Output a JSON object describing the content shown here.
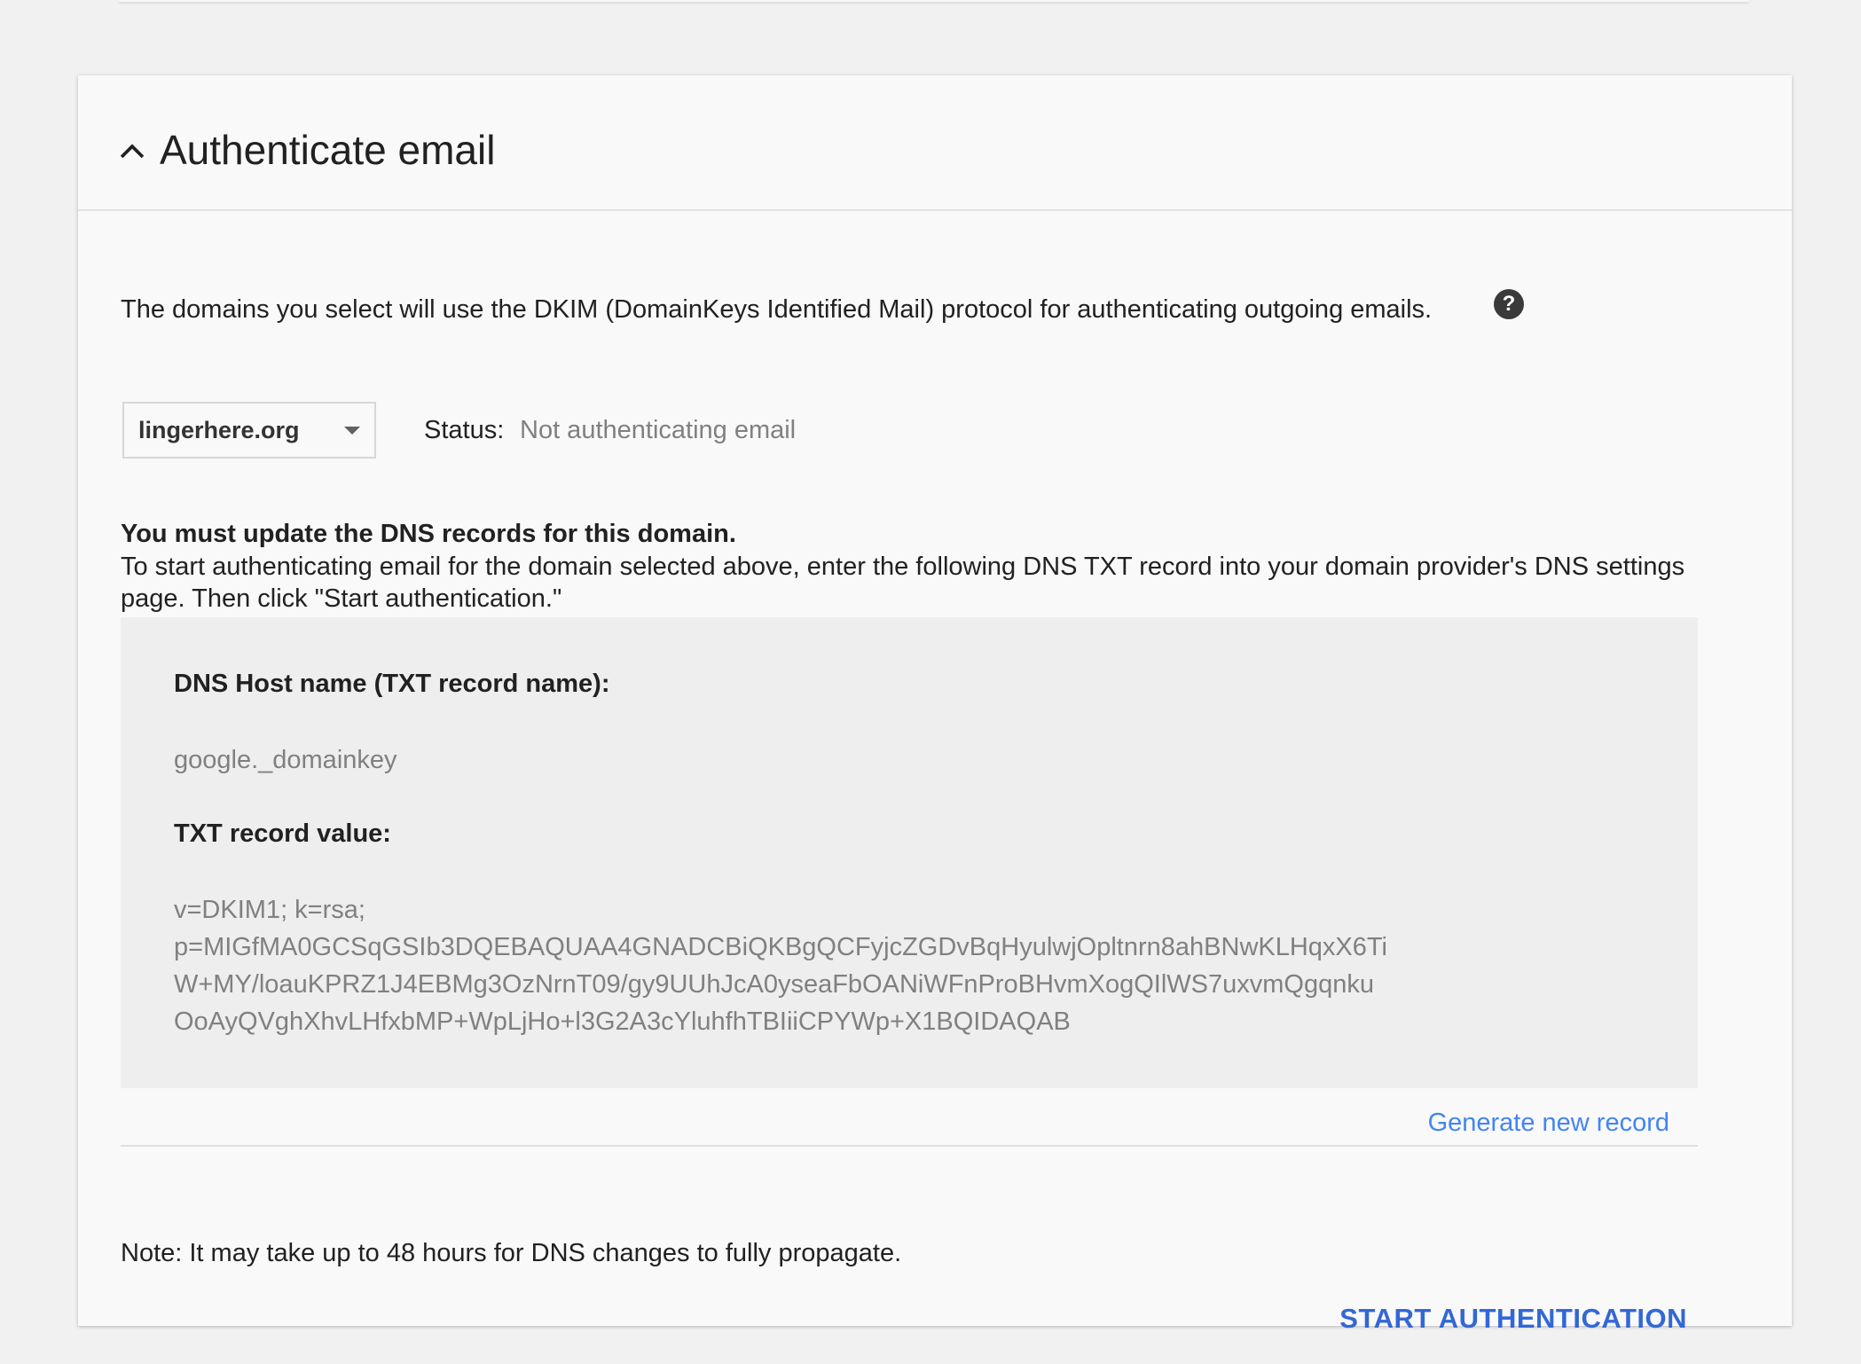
{
  "card": {
    "title": "Authenticate email"
  },
  "description": "The domains you select will use the DKIM (DomainKeys Identified Mail) protocol for authenticating outgoing emails.",
  "help_icon": "?",
  "domain_select": {
    "value": "lingerhere.org"
  },
  "status": {
    "label": "Status:",
    "value": "Not authenticating email"
  },
  "dns": {
    "warning_title": "You must update the DNS records for this domain.",
    "instructions": "To start authenticating email for the domain selected above, enter the following DNS TXT record into your domain provider's DNS settings page. Then click \"Start authentication.\"",
    "host_label": "DNS Host name (TXT record name):",
    "host_value": "google._domainkey",
    "txt_label": "TXT record value:",
    "txt_value": "v=DKIM1; k=rsa;\np=MIGfMA0GCSqGSIb3DQEBAQUAA4GNADCBiQKBgQCFyjcZGDvBqHyulwjOpltnrn8ahBNwKLHqxX6Ti\nW+MY/loauKPRZ1J4EBMg3OzNrnT09/gy9UUhJcA0yseaFbOANiWFnProBHvmXogQIlWS7uxvmQgqnku\nOoAyQVghXhvLHfxbMP+WpLjHo+l3G2A3cYluhfhTBIiiCPYWp+X1BQIDAQAB"
  },
  "generate_link": "Generate new record",
  "note": "Note: It may take up to 48 hours for DNS changes to fully propagate.",
  "start_button": "START AUTHENTICATION",
  "icons": {
    "collapse": "chevron-up-icon",
    "dropdown": "arrow-drop-down-icon",
    "help": "help-icon"
  },
  "colors": {
    "link": "#4285f4",
    "primary_button": "#3367d6",
    "muted_text": "#808080",
    "record_background": "#eeeeee"
  }
}
